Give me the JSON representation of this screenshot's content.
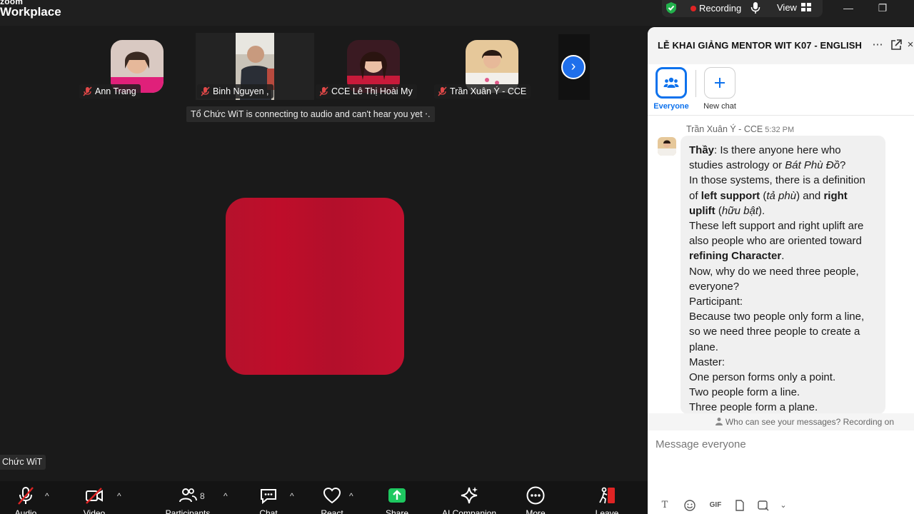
{
  "app": {
    "logo_top": "zoom",
    "logo_bottom": "Workplace"
  },
  "titlebar": {
    "recording_label": "Recording",
    "view_label": "View",
    "minimize": "—",
    "restore": "❐"
  },
  "participants": [
    {
      "name": "Ann Trang"
    },
    {
      "name": "Binh Nguyen ,"
    },
    {
      "name": "CCE Lê Thị Hoài My"
    },
    {
      "name": "Trần Xuân Ý - CCE"
    }
  ],
  "notice": "Tổ Chức WiT is connecting to audio and can't hear you yet  ‧.",
  "active_speaker": "Chức WiT",
  "colors": {
    "accent": "#0e72ed",
    "recording": "#e02424",
    "video_tile": "#bf0d2a",
    "share": "#1ec860"
  },
  "toolbar": {
    "audio": "Audio",
    "video": "Video",
    "participants": "Participants",
    "participants_count": "8",
    "chat": "Chat",
    "react": "React",
    "share": "Share",
    "ai": "AI Companion",
    "more": "More",
    "leave": "Leave"
  },
  "chat": {
    "title": "LỄ KHAI GIẢNG MENTOR WIT K07 - ENGLISH",
    "recipients": [
      {
        "label": "Everyone",
        "icon": "people-icon"
      },
      {
        "label": "New chat",
        "icon": "plus-icon"
      }
    ],
    "message": {
      "sender": "Trần Xuân Ý - CCE",
      "time": "5:32 PM",
      "lines": [
        {
          "b": "Thầy",
          "t": ": Is there anyone here who"
        },
        {
          "t": "studies astrology or ",
          "i": "Bát Phù Đồ",
          "t2": "?"
        },
        {
          "t": "In those systems, there is a definition"
        },
        {
          "t": "of ",
          "b": "left support",
          "t2": " (",
          "i": "tả phù",
          "t3": ") and ",
          "b2": "right"
        },
        {
          "b": "uplift",
          "t": " (",
          "i": "hữu bật",
          "t2": ")."
        },
        {
          "t": "These left support and right uplift are"
        },
        {
          "t": "also people who are oriented toward"
        },
        {
          "b": "refining Character",
          "t": "."
        },
        {
          "t": "Now, why do we need three people,"
        },
        {
          "t": "everyone?"
        },
        {
          "t": "Participant:"
        },
        {
          "t": "Because two people only form a line,"
        },
        {
          "t": "so we need three people to create a"
        },
        {
          "t": "plane."
        },
        {
          "t": "Master:"
        },
        {
          "t": "One person forms only a point."
        },
        {
          "t": "Two people form a line."
        },
        {
          "t": "Three people form a plane."
        }
      ]
    },
    "visibility_note": "Who can see your messages? Recording on",
    "input_placeholder": "Message everyone",
    "format_icons": [
      "text-format-icon",
      "emoji-icon",
      "gif-icon",
      "file-icon",
      "screenshot-icon"
    ],
    "gif_label": "GIF"
  }
}
